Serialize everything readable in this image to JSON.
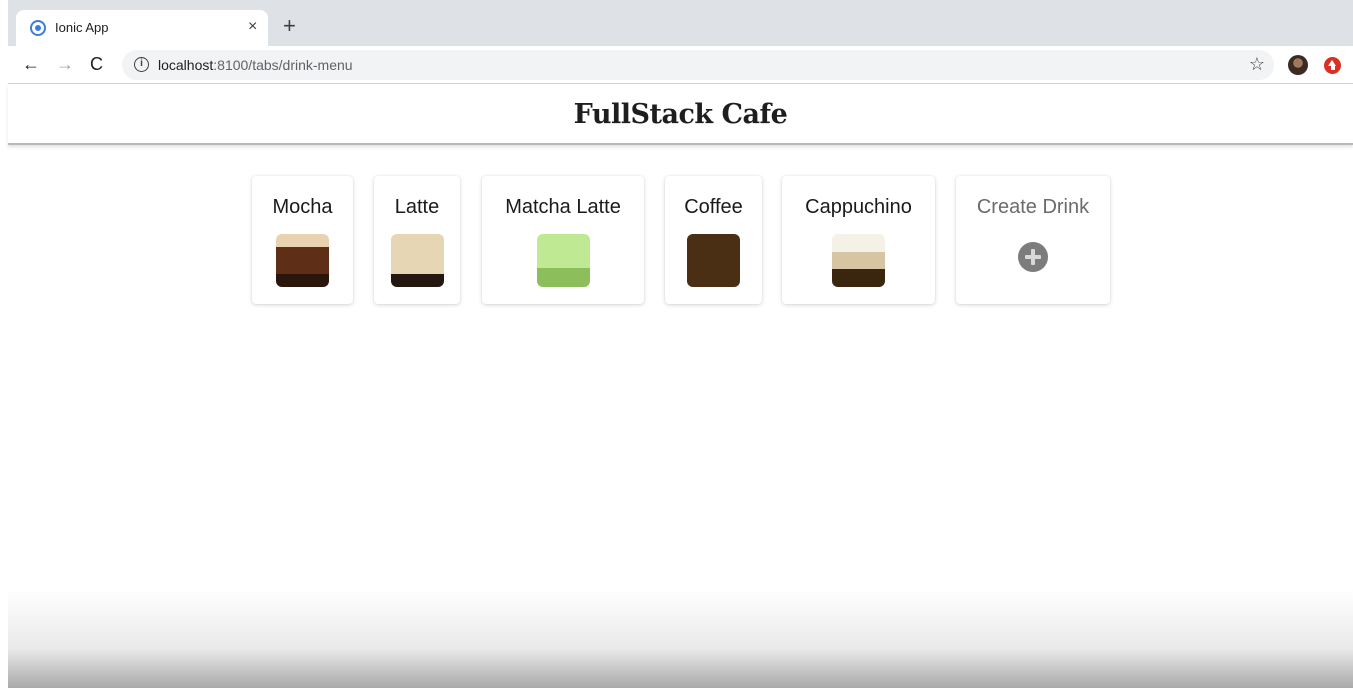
{
  "browser": {
    "tab_title": "Ionic App",
    "tab_close_glyph": "×",
    "new_tab_glyph": "+",
    "back_glyph": "←",
    "forward_glyph": "→",
    "reload_glyph": "C",
    "info_glyph": "i",
    "url_host": "localhost",
    "url_path": ":8100/tabs/drink-menu",
    "star_glyph": "☆",
    "icons": [
      "ionic-favicon-icon",
      "back-arrow-icon",
      "forward-arrow-icon",
      "reload-icon",
      "info-icon",
      "bookmark-star-icon",
      "profile-avatar",
      "extension-update-icon"
    ]
  },
  "app": {
    "title": "FullStack Cafe"
  },
  "drinks": [
    {
      "name": "Mocha",
      "layers": [
        {
          "color": "#e8d2b0",
          "weight": 13
        },
        {
          "color": "#5e2e17",
          "weight": 27
        },
        {
          "color": "#2b160c",
          "weight": 13
        }
      ]
    },
    {
      "name": "Latte",
      "layers": [
        {
          "color": "#e6d6b4",
          "weight": 40
        },
        {
          "color": "#231710",
          "weight": 13
        }
      ]
    },
    {
      "name": "Matcha Latte",
      "layers": [
        {
          "color": "#bfea93",
          "weight": 34
        },
        {
          "color": "#8cbf5c",
          "weight": 19
        }
      ]
    },
    {
      "name": "Coffee",
      "layers": [
        {
          "color": "#4a2f14",
          "weight": 53
        }
      ]
    },
    {
      "name": "Cappuchino",
      "layers": [
        {
          "color": "#f4f1e6",
          "weight": 18
        },
        {
          "color": "#d7c4a3",
          "weight": 17
        },
        {
          "color": "#3a260e",
          "weight": 18
        }
      ]
    }
  ],
  "create": {
    "label": "Create Drink",
    "icon": "add-circle-icon"
  },
  "colors": {
    "header_border": "#b9b9b9",
    "accent_blue": "#3b7ddd"
  }
}
